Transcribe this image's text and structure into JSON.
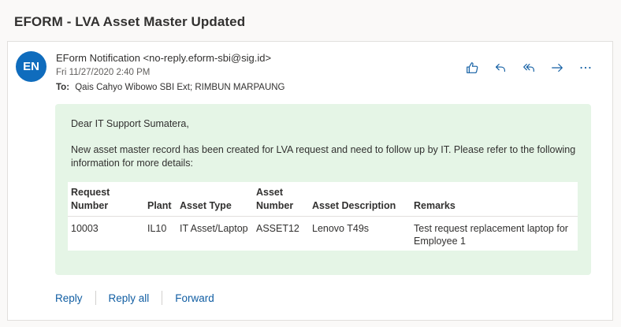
{
  "subject": "EFORM - LVA Asset Master Updated",
  "message": {
    "avatar_initials": "EN",
    "sender": "EForm Notification <no-reply.eform-sbi@sig.id>",
    "date": "Fri 11/27/2020 2:40 PM",
    "to_label": "To:",
    "recipients": "Qais Cahyo Wibowo SBI Ext; RIMBUN MARPAUNG"
  },
  "actions": [
    "like-icon",
    "reply-icon",
    "reply-all-icon",
    "forward-icon",
    "more-icon"
  ],
  "body": {
    "greeting": "Dear IT Support Sumatera,",
    "paragraph": "New asset master record has been created for LVA request and need to follow up by IT. Please refer to the following information for more details:",
    "table": {
      "headers": [
        "Request Number",
        "Plant",
        "Asset Type",
        "Asset Number",
        "Asset Description",
        "Remarks"
      ],
      "rows": [
        [
          "10003",
          "IL10",
          "IT Asset/Laptop",
          "ASSET12",
          "Lenovo T49s",
          "Test request replacement laptop for Employee 1"
        ]
      ]
    }
  },
  "footer": {
    "reply": "Reply",
    "reply_all": "Reply all",
    "forward": "Forward"
  },
  "colors": {
    "accent": "#0f6cbd",
    "link": "#115ea3",
    "body_bg": "#e5f5e6"
  }
}
